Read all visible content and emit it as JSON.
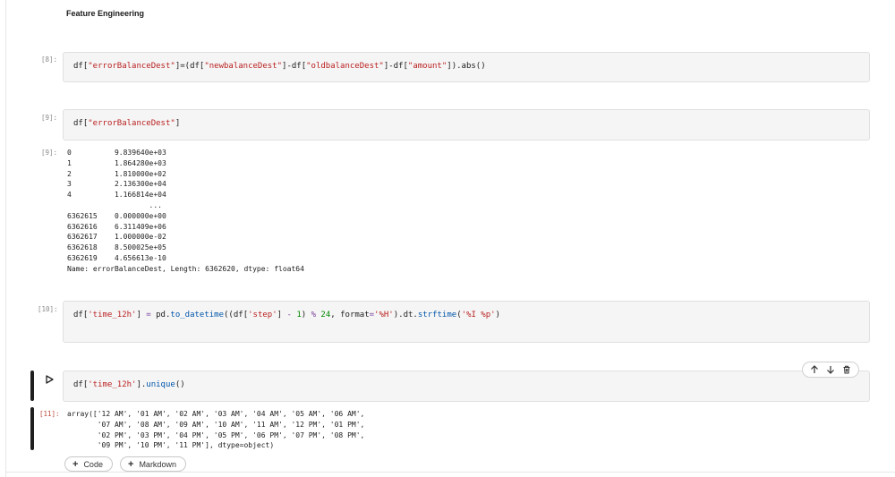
{
  "heading": "Feature Engineering",
  "cells": {
    "c8": {
      "prompt": "[8]:",
      "tokens": [
        "df[",
        "\"errorBalanceDest\"",
        "]=(df[",
        "\"newbalanceDest\"",
        "]-df[",
        "\"oldbalanceDest\"",
        "]-df[",
        "\"amount\"",
        "]).abs()"
      ]
    },
    "c9": {
      "prompt": "[9]:",
      "tokens": [
        "df[",
        "\"errorBalanceDest\"",
        "]"
      ],
      "out_prompt": "[9]:",
      "output": "0          9.839640e+03\n1          1.864280e+03\n2          1.810000e+02\n3          2.136300e+04\n4          1.166814e+04\n                   ...\n6362615    0.000000e+00\n6362616    6.311409e+06\n6362617    1.000000e-02\n6362618    8.500025e+05\n6362619    4.656613e-10\nName: errorBalanceDest, Length: 6362620, dtype: float64"
    },
    "c10": {
      "prompt": "[10]:",
      "tokens": [
        "df[",
        "'time_12h'",
        "] ",
        "=",
        " pd.",
        "to_datetime",
        "((df[",
        "'step'",
        "] ",
        "-",
        " ",
        "1",
        ") ",
        "%",
        " ",
        "24",
        ", format",
        "=",
        "'%H'",
        ").dt.",
        "strftime",
        "(",
        "'%I %p'",
        ")"
      ]
    },
    "c11": {
      "tokens": [
        "df[",
        "'time_12h'",
        "].",
        "unique",
        "()"
      ],
      "out_prompt": "[11]:",
      "output": "array(['12 AM', '01 AM', '02 AM', '03 AM', '04 AM', '05 AM', '06 AM',\n       '07 AM', '08 AM', '09 AM', '10 AM', '11 AM', '12 PM', '01 PM',\n       '02 PM', '03 PM', '04 PM', '05 PM', '06 PM', '07 PM', '08 PM',\n       '09 PM', '10 PM', '11 PM'], dtype=object)"
    }
  },
  "add_code_label": "Code",
  "add_markdown_label": "Markdown",
  "icons": {
    "run": "play-icon",
    "move_up": "arrow-up-icon",
    "move_down": "arrow-down-icon",
    "delete": "trash-icon",
    "add": "plus-icon"
  },
  "colors": {
    "string": "#ba2121",
    "function": "#0055aa",
    "number": "#008800",
    "operator": "#7a3e9d"
  }
}
